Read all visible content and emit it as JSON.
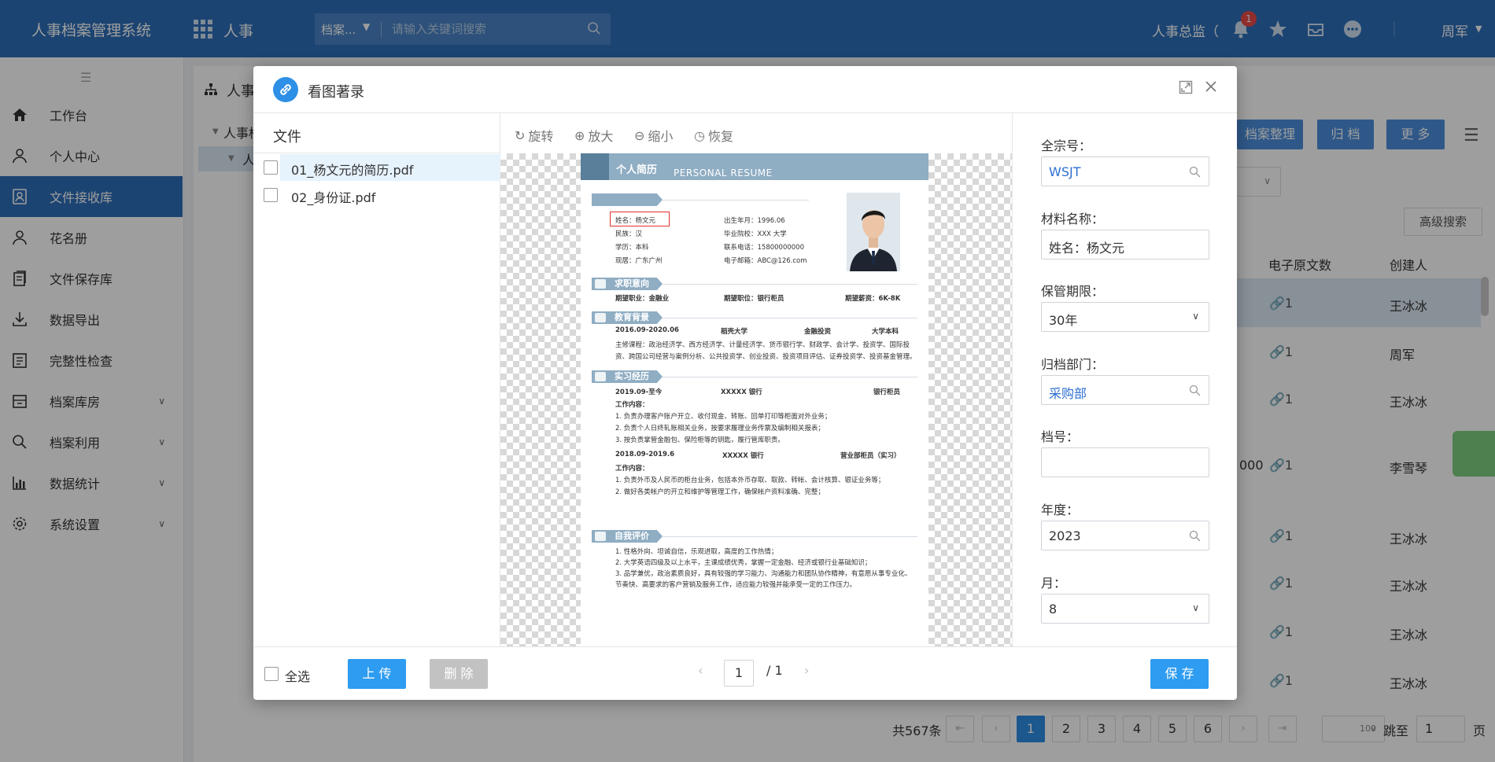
{
  "app": {
    "title": "人事档案管理系统",
    "module": "人事",
    "search_scope": "档案...",
    "search_placeholder": "请输入关键词搜索",
    "user_role": "人事总监（",
    "notification_count": "1",
    "user_name": "周军"
  },
  "sidebar": {
    "items": [
      {
        "label": "工作台",
        "icon": "home-icon"
      },
      {
        "label": "个人中心",
        "icon": "user-icon"
      },
      {
        "label": "文件接收库",
        "icon": "inbox-icon",
        "active": true
      },
      {
        "label": "花名册",
        "icon": "roster-icon"
      },
      {
        "label": "文件保存库",
        "icon": "files-icon"
      },
      {
        "label": "数据导出",
        "icon": "download-icon"
      },
      {
        "label": "完整性检查",
        "icon": "checklist-icon"
      },
      {
        "label": "档案库房",
        "icon": "warehouse-icon",
        "expandable": true
      },
      {
        "label": "档案利用",
        "icon": "search-icon",
        "expandable": true
      },
      {
        "label": "数据统计",
        "icon": "bar-chart-icon",
        "expandable": true
      },
      {
        "label": "系统设置",
        "icon": "gear-icon",
        "expandable": true
      }
    ]
  },
  "background": {
    "title": "人事",
    "tree": [
      "人事档",
      "人"
    ],
    "buttons": [
      "档案整理",
      "归 档",
      "更 多"
    ],
    "advanced_search": "高级搜索",
    "columns": [
      "电子原文数",
      "创建人"
    ],
    "rows": [
      {
        "count": "1",
        "creator": "王冰冰"
      },
      {
        "count": "1",
        "creator": "周军"
      },
      {
        "count": "1",
        "creator": "王冰冰"
      },
      {
        "count": "1",
        "creator": "李雪琴",
        "extra": "000"
      },
      {
        "count": "1",
        "creator": "王冰冰"
      },
      {
        "count": "1",
        "creator": "王冰冰"
      },
      {
        "count": "1",
        "creator": "王冰冰"
      },
      {
        "count": "1",
        "creator": "王冰冰"
      }
    ],
    "pagination": {
      "total": "共567条",
      "pages": [
        "1",
        "2",
        "3",
        "4",
        "5",
        "6"
      ],
      "current": "1",
      "page_size": "100",
      "jump_label": "跳至",
      "jump_value": "1",
      "jump_suffix": "页"
    }
  },
  "modal": {
    "title": "看图著录",
    "files_header": "文件",
    "files": [
      {
        "name": "01_杨文元的简历.pdf",
        "selected": true
      },
      {
        "name": "02_身份证.pdf",
        "selected": false
      }
    ],
    "toolbar": {
      "rotate": "旋转",
      "zoom_in": "放大",
      "zoom_out": "缩小",
      "reset": "恢复"
    },
    "resume": {
      "header_cn": "个人简历",
      "header_en": "PERSONAL    RESUME",
      "basic": [
        [
          "姓名：杨文元",
          "出生年月：1996.06"
        ],
        [
          "民族：汉",
          "毕业院校：XXX 大学"
        ],
        [
          "学历：本科",
          "联系电话：15800000000"
        ],
        [
          "现居：广东广州",
          "电子邮箱：ABC@126.com"
        ]
      ],
      "sections": {
        "intent": "求职意向",
        "education": "教育背景",
        "internship": "实习经历",
        "self_eval": "自我评价"
      },
      "intent": [
        "期望职业：金融业",
        "期望职位：银行柜员",
        "期望薪资：6K-8K"
      ],
      "education": {
        "period": "2016.09-2020.06",
        "school": "稻壳大学",
        "major": "金融投资",
        "degree": "大学本科",
        "courses_1": "主修课程：政治经济学、西方经济学、计量经济学、货币银行学、财政学、会计学、投资学、国际投",
        "courses_2": "资、跨国公司经营与案例分析、公共投资学、创业投资、投资项目评估、证券投资学、投资基金管理。"
      },
      "jobs": [
        {
          "period": "2019.09-至今",
          "company": "XXXXX 银行",
          "role": "银行柜员",
          "content_label": "工作内容：",
          "items": [
            "1. 负责办理客户账户开立、收付现金、转账、回单打印等柜面对外业务；",
            "2. 负责个人日终轧账相关业务，按要求履理业务传票及编制相关报表；",
            "3. 按负责掌管金融包、保险柜等的钥匙，履行管库职责。"
          ]
        },
        {
          "period": "2018.09-2019.6",
          "company": "XXXXX 银行",
          "role": "营业部柜员（实习）",
          "content_label": "工作内容：",
          "items": [
            "1. 负责外币及人民币的柜台业务，包括本外币存取、取款、转帐、会计核算、银证业务等；",
            "2. 做好各类帐户的开立和维护等管理工作，确保帐户资料准确、完整；"
          ]
        }
      ],
      "self_eval": [
        "1. 性格外向、坦诚自信，乐观进取，高度的工作热情；",
        "2. 大学英语四级及以上水平，主课成绩优秀，掌握一定金融、经济或银行业基础知识；",
        "3. 品学兼优，政治素质良好，具有较强的学习能力、沟通能力和团队协作精神，有意愿从事专业化、",
        "   节奏快、高要求的客户营销及服务工作，适应能力较强并能承受一定的工作压力。"
      ]
    },
    "form": {
      "fields": [
        {
          "label": "全宗号：",
          "value": "WSJT",
          "kind": "search",
          "style": "blue"
        },
        {
          "label": "材料名称：",
          "value": "姓名：杨文元",
          "kind": "text"
        },
        {
          "label": "保管期限：",
          "value": "30年",
          "kind": "select"
        },
        {
          "label": "归档部门：",
          "value": "采购部",
          "kind": "search",
          "style": "blue"
        },
        {
          "label": "档号：",
          "value": "",
          "kind": "text"
        },
        {
          "label": "年度：",
          "value": "2023",
          "kind": "search"
        },
        {
          "label": "月：",
          "value": "8",
          "kind": "select"
        }
      ]
    },
    "footer": {
      "select_all": "全选",
      "upload": "上 传",
      "delete": "删 除",
      "page": "1",
      "page_total": "/ 1",
      "save": "保 存"
    }
  },
  "colors": {
    "topbar": "#2e6fb8",
    "primary_button": "#2e9cf0",
    "active_menu": "#2e6fb8"
  }
}
